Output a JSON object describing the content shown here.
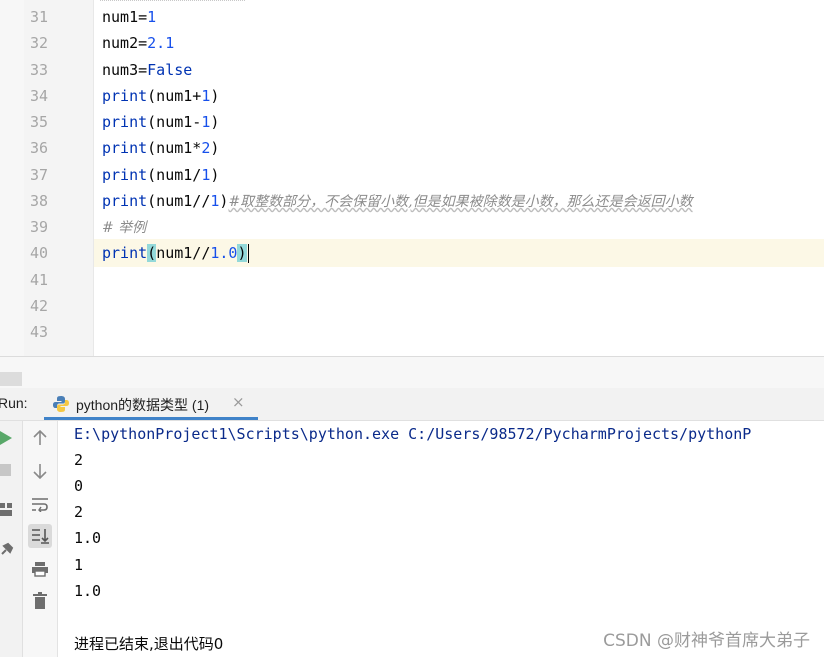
{
  "editor": {
    "line_numbers": [
      "31",
      "32",
      "33",
      "34",
      "35",
      "36",
      "37",
      "38",
      "39",
      "40",
      "41",
      "42",
      "43"
    ],
    "lines": [
      {
        "a": "num1=",
        "b": "1"
      },
      {
        "a": "num2=",
        "b": "2.1"
      },
      {
        "a": "num3=",
        "b": "False"
      },
      {
        "a": "print",
        "b": "(num1+",
        "c": "1",
        "d": ")"
      },
      {
        "a": "print",
        "b": "(num1-",
        "c": "1",
        "d": ")"
      },
      {
        "a": "print",
        "b": "(num1*",
        "c": "2",
        "d": ")"
      },
      {
        "a": "print",
        "b": "(num1/",
        "c": "1",
        "d": ")"
      },
      {
        "a": "print",
        "b": "(num1//",
        "c": "1",
        "d": ")",
        "comment": "#取整数部分，不会保留小数,但是如果被除数是小数，那么还是会返回小数"
      },
      {
        "comment": "# 举例"
      },
      {
        "a": "print",
        "b_open": "(",
        "b": "num1//",
        "c": "1.0",
        "d": ")"
      }
    ],
    "current_line": "40"
  },
  "run_panel": {
    "label": "Run:",
    "tab_label": "python的数据类型 (1)",
    "tab_close": "×"
  },
  "console": {
    "command": "E:\\pythonProject1\\Scripts\\python.exe C:/Users/98572/PycharmProjects/pythonP",
    "outputs": [
      "2",
      "0",
      "2",
      "1.0",
      "1",
      "1.0"
    ],
    "exit_message": "进程已结束,退出代码0"
  },
  "watermark": "CSDN @财神爷首席大弟子",
  "colors": {
    "number": "#1750eb",
    "keyword": "#0033b3",
    "comment": "#8c8c8c",
    "current_line_bg": "#fcf8e6",
    "brace_highlight": "#93d9d9",
    "run_green": "#59a869"
  },
  "icons": {
    "run": "run-icon",
    "stop": "stop-icon",
    "layout": "layout-icon",
    "pin": "pin-icon",
    "up": "arrow-up-icon",
    "down": "arrow-down-icon",
    "soft_wrap": "soft-wrap-icon",
    "scroll_end": "scroll-to-end-icon",
    "print": "print-icon",
    "trash": "trash-icon",
    "python": "python-icon"
  }
}
